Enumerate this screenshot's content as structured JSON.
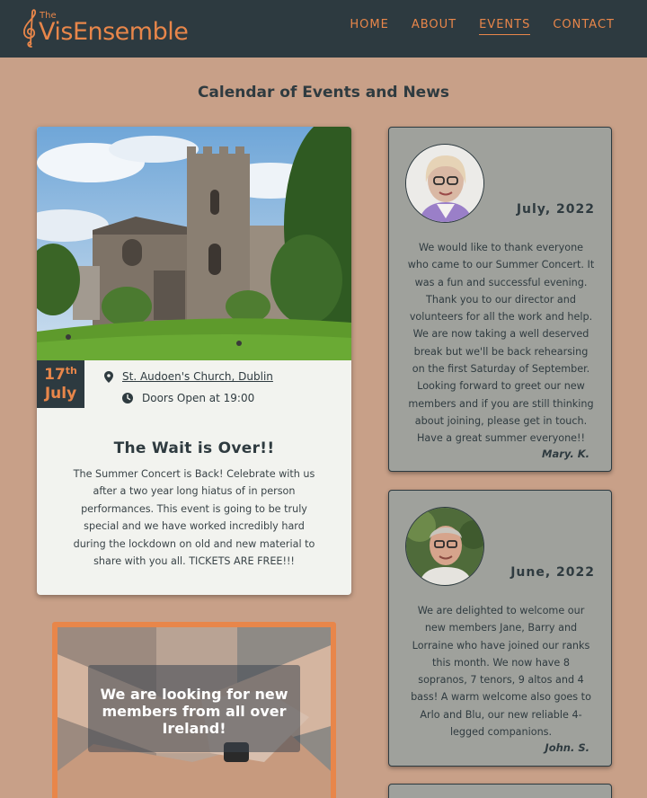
{
  "brand": {
    "the": "The",
    "name": "VisEnsemble",
    "accent": "#e8864a",
    "nav_bg": "#2d3a40"
  },
  "nav": {
    "items": [
      "HOME",
      "ABOUT",
      "EVENTS",
      "CONTACT"
    ],
    "active": "EVENTS"
  },
  "page_title": "Calendar of Events and News",
  "event": {
    "day": "17",
    "day_suffix": "th",
    "month": "July",
    "venue": "St. Audoen's Church, Dublin",
    "time": "Doors Open at 19:00",
    "title": "The Wait is Over!!",
    "body": "The Summer Concert is Back! Celebrate with us after a two year long hiatus of in person performances. This event is going to be truly special and we have worked incredibly hard during the lockdown on old and new material to share with you all. TICKETS ARE FREE!!!",
    "icons": [
      "location-pin-icon",
      "clock-icon"
    ]
  },
  "recruit": {
    "text": "We are looking for new members from all over Ireland!"
  },
  "news": [
    {
      "date": "July, 2022",
      "body": "We would like to thank everyone who came to our Summer Concert. It was a fun and successful evening. Thank you to our director and volunteers for all the work and help. We are now taking a well deserved break but we'll be back rehearsing on the first Saturday of September. Looking forward to greet our new members and if you are still thinking about joining, please get in touch. Have a great summer everyone!!",
      "signature": "Mary. K."
    },
    {
      "date": "June, 2022",
      "body": "We are delighted to welcome our new members Jane, Barry and Lorraine who have joined our ranks this month. We now have 8 sopranos, 7 tenors, 9 altos and 4 bass! A warm welcome also goes to Arlo and Blu, our new reliable 4-legged companions.",
      "signature": "John. S."
    }
  ],
  "colors": {
    "page_bg": "#c8a088",
    "card_bg": "#f2f3ef",
    "news_bg": "#9fa19c",
    "text": "#2f3b40"
  }
}
